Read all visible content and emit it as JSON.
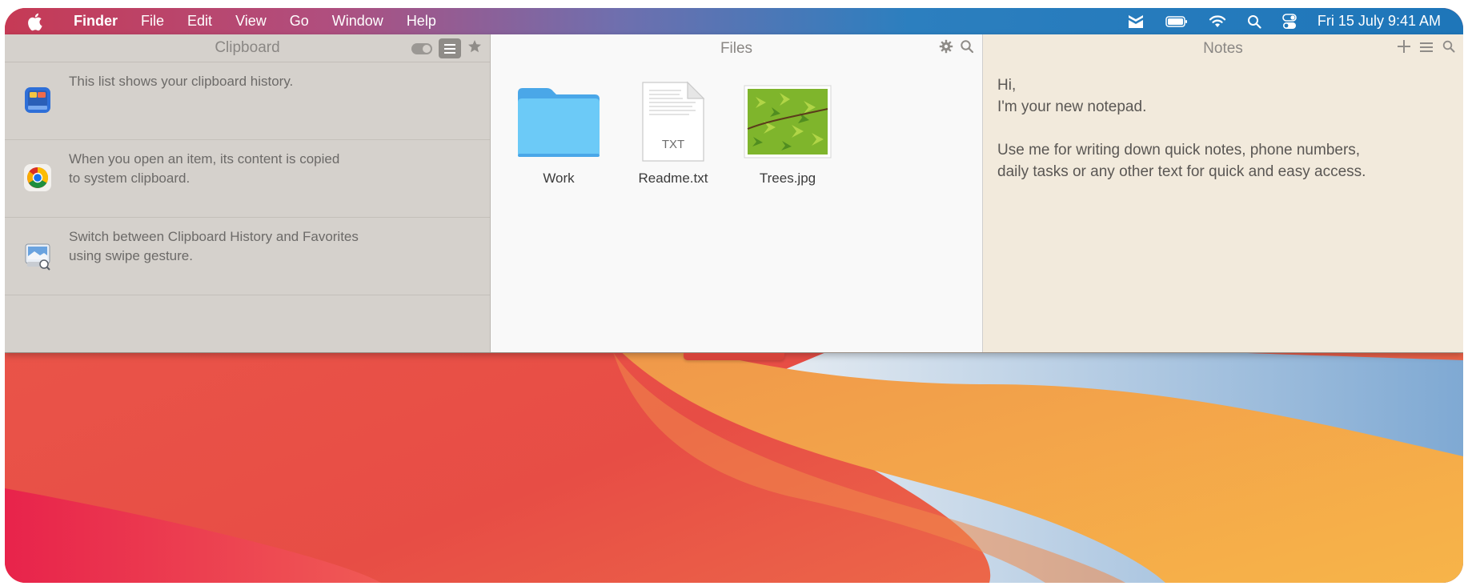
{
  "menubar": {
    "apple_icon": "apple-logo-icon",
    "app_name": "Finder",
    "menus": [
      "File",
      "Edit",
      "View",
      "Go",
      "Window",
      "Help"
    ],
    "status_icons": [
      "dropzone-tray-icon",
      "battery-icon",
      "wifi-icon",
      "spotlight-search-icon",
      "control-center-icon"
    ],
    "clock": "Fri 15 July  9:41 AM"
  },
  "clipboard": {
    "title": "Clipboard",
    "tools": [
      "toggle-icon",
      "list-icon",
      "star-icon"
    ],
    "items": [
      {
        "icon": "notes-app-icon",
        "text": "This list shows your clipboard history."
      },
      {
        "icon": "chrome-app-icon",
        "text": "When you open an item, its content is copied\nto system clipboard."
      },
      {
        "icon": "preview-app-icon",
        "text": "Switch between Clipboard History and Favorites\nusing swipe gesture."
      }
    ]
  },
  "files": {
    "title": "Files",
    "tools": [
      "gear-icon",
      "search-icon"
    ],
    "items": [
      {
        "name": "Work",
        "kind": "folder-icon"
      },
      {
        "name": "Readme.txt",
        "kind": "txt-file-icon",
        "badge": "TXT"
      },
      {
        "name": "Trees.jpg",
        "kind": "image-thumbnail"
      }
    ]
  },
  "notes": {
    "title": "Notes",
    "tools": [
      "plus-icon",
      "list-icon",
      "search-icon"
    ],
    "lines": [
      "Hi,",
      "I'm your new notepad.",
      "",
      "Use me for writing down quick notes, phone numbers,",
      "daily tasks or any other text for quick and easy access."
    ]
  },
  "colors": {
    "accent_menubar_left": "#c63a55",
    "accent_menubar_right": "#1e76b9",
    "clipboard_bg": "#d5d1cc",
    "files_bg": "#f9f9f9",
    "notes_bg": "#f2eadc"
  }
}
